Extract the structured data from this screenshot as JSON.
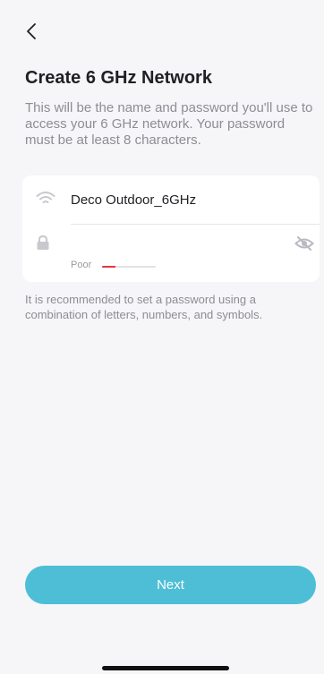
{
  "header": {
    "title": "Create 6 GHz Network",
    "description": "This will be the name and password you'll use to access your 6 GHz network. Your password must be at least 8 characters."
  },
  "form": {
    "ssid_value": "Deco Outdoor_6GHz",
    "ssid_icon": "wifi-icon",
    "password_value": "",
    "password_icon": "lock-icon",
    "visibility_icon": "eye-off-icon",
    "strength_label": "Poor",
    "strength_level": 0.25
  },
  "hint": "It is recommended to set a password using a combination of letters, numbers, and symbols.",
  "actions": {
    "next_label": "Next"
  },
  "colors": {
    "accent": "#4dbed6",
    "strength_poor": "#e8353f",
    "background": "#f6f6f8"
  }
}
